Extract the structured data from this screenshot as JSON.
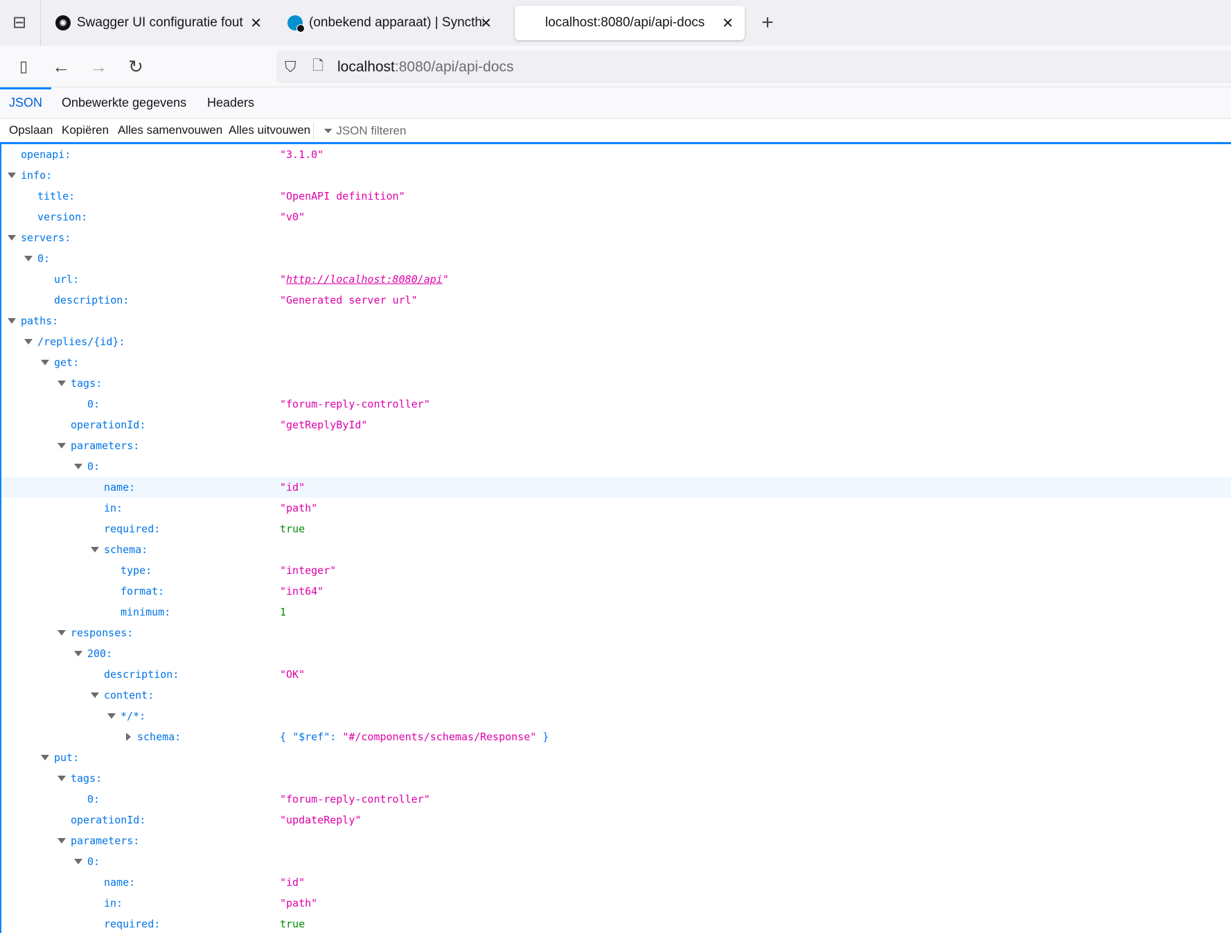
{
  "browser": {
    "tabs": [
      {
        "title": "Swagger UI configuratie fout",
        "icon": "openai-icon",
        "active": false
      },
      {
        "title": "(onbekend apparaat) | Syncthing",
        "icon": "syncthing-warning-icon",
        "active": false
      },
      {
        "title": "localhost:8080/api/api-docs",
        "icon": "",
        "active": true
      }
    ],
    "new_tab": "+",
    "close": "✕",
    "url_host": "localhost",
    "url_rest": ":8080/api/api-docs"
  },
  "viewer": {
    "tabs": [
      "JSON",
      "Onbewerkte gegevens",
      "Headers"
    ],
    "toolbar": [
      "Opslaan",
      "Kopiëren",
      "Alles samenvouwen",
      "Alles uitvouwen"
    ],
    "filter_placeholder": "JSON filteren"
  },
  "colors": {
    "key": "#0074e8",
    "string": "#dd00a9",
    "literal": "#058b00",
    "accent": "#0a84ff"
  },
  "rows": [
    {
      "level": 0,
      "toggle": "none",
      "key": "openapi:",
      "value": "\"3.1.0\"",
      "type": "string"
    },
    {
      "level": 0,
      "toggle": "open",
      "key": "info:"
    },
    {
      "level": 1,
      "toggle": "none",
      "key": "title:",
      "value": "\"OpenAPI definition\"",
      "type": "string"
    },
    {
      "level": 1,
      "toggle": "none",
      "key": "version:",
      "value": "\"v0\"",
      "type": "string"
    },
    {
      "level": 0,
      "toggle": "open",
      "key": "servers:"
    },
    {
      "level": 1,
      "toggle": "open",
      "key": "0:"
    },
    {
      "level": 2,
      "toggle": "none",
      "key": "url:",
      "value": "http://localhost:8080/api",
      "type": "link"
    },
    {
      "level": 2,
      "toggle": "none",
      "key": "description:",
      "value": "\"Generated server url\"",
      "type": "string"
    },
    {
      "level": 0,
      "toggle": "open",
      "key": "paths:"
    },
    {
      "level": 1,
      "toggle": "open",
      "key": "/replies/{id}:"
    },
    {
      "level": 2,
      "toggle": "open",
      "key": "get:"
    },
    {
      "level": 3,
      "toggle": "open",
      "key": "tags:"
    },
    {
      "level": 4,
      "toggle": "none",
      "key": "0:",
      "value": "\"forum-reply-controller\"",
      "type": "string"
    },
    {
      "level": 3,
      "toggle": "none",
      "key": "operationId:",
      "value": "\"getReplyById\"",
      "type": "string"
    },
    {
      "level": 3,
      "toggle": "open",
      "key": "parameters:"
    },
    {
      "level": 4,
      "toggle": "open",
      "key": "0:"
    },
    {
      "level": 5,
      "toggle": "none",
      "key": "name:",
      "value": "\"id\"",
      "type": "string",
      "highlighted": true
    },
    {
      "level": 5,
      "toggle": "none",
      "key": "in:",
      "value": "\"path\"",
      "type": "string"
    },
    {
      "level": 5,
      "toggle": "none",
      "key": "required:",
      "value": "true",
      "type": "bool"
    },
    {
      "level": 5,
      "toggle": "open",
      "key": "schema:"
    },
    {
      "level": 6,
      "toggle": "none",
      "key": "type:",
      "value": "\"integer\"",
      "type": "string"
    },
    {
      "level": 6,
      "toggle": "none",
      "key": "format:",
      "value": "\"int64\"",
      "type": "string"
    },
    {
      "level": 6,
      "toggle": "none",
      "key": "minimum:",
      "value": "1",
      "type": "number"
    },
    {
      "level": 3,
      "toggle": "open",
      "key": "responses:"
    },
    {
      "level": 4,
      "toggle": "open",
      "key": "200:"
    },
    {
      "level": 5,
      "toggle": "none",
      "key": "description:",
      "value": "\"OK\"",
      "type": "string"
    },
    {
      "level": 5,
      "toggle": "open",
      "key": "content:"
    },
    {
      "level": 6,
      "toggle": "open",
      "key": "*/*:"
    },
    {
      "level": 7,
      "toggle": "closed",
      "key": "schema:",
      "preview": {
        "open": "{ ",
        "k": "\"$ref\"",
        "sep": ": ",
        "v": "\"#/components/schemas/Response\"",
        "close": " }"
      }
    },
    {
      "level": 2,
      "toggle": "open",
      "key": "put:"
    },
    {
      "level": 3,
      "toggle": "open",
      "key": "tags:"
    },
    {
      "level": 4,
      "toggle": "none",
      "key": "0:",
      "value": "\"forum-reply-controller\"",
      "type": "string"
    },
    {
      "level": 3,
      "toggle": "none",
      "key": "operationId:",
      "value": "\"updateReply\"",
      "type": "string"
    },
    {
      "level": 3,
      "toggle": "open",
      "key": "parameters:"
    },
    {
      "level": 4,
      "toggle": "open",
      "key": "0:"
    },
    {
      "level": 5,
      "toggle": "none",
      "key": "name:",
      "value": "\"id\"",
      "type": "string"
    },
    {
      "level": 5,
      "toggle": "none",
      "key": "in:",
      "value": "\"path\"",
      "type": "string"
    },
    {
      "level": 5,
      "toggle": "none",
      "key": "required:",
      "value": "true",
      "type": "bool"
    }
  ]
}
